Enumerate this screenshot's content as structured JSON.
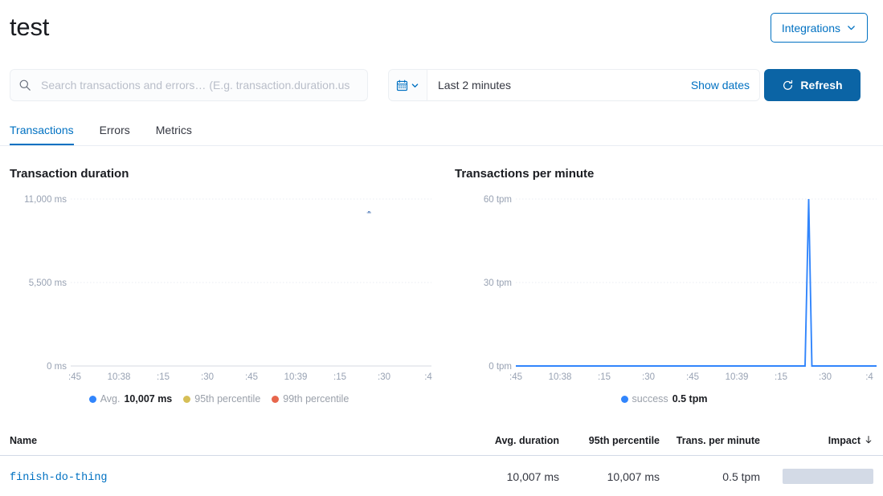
{
  "header": {
    "title": "test",
    "integrations_label": "Integrations",
    "integrations_icon": "chevron-down-icon"
  },
  "search": {
    "icon": "search-icon",
    "placeholder": "Search transactions and errors… (E.g. transaction.duration.us",
    "value": ""
  },
  "datepicker": {
    "calendar_icon": "calendar-icon",
    "chevron_icon": "chevron-down-icon",
    "range_label": "Last 2 minutes",
    "show_dates_label": "Show dates"
  },
  "refresh": {
    "label": "Refresh",
    "icon": "refresh-icon",
    "color": "#0b64a5"
  },
  "tabs": [
    {
      "label": "Transactions",
      "active": true
    },
    {
      "label": "Errors",
      "active": false
    },
    {
      "label": "Metrics",
      "active": false
    }
  ],
  "colors": {
    "accent": "#0071c2",
    "series_blue": "#3185fc",
    "series_yellow": "#d6bf57",
    "series_orange": "#e7664c",
    "grid": "#e9edf3",
    "impact_bar": "#d3dae6"
  },
  "chart_data": [
    {
      "id": "transaction-duration",
      "type": "line",
      "title": "Transaction duration",
      "xlabel": "",
      "ylabel": "",
      "ylim": [
        0,
        11000
      ],
      "yticks": [
        0,
        5500,
        11000
      ],
      "ytick_labels": [
        "0 ms",
        "5,500 ms",
        "11,000 ms"
      ],
      "xtick_labels": [
        ":45",
        "10:38",
        ":15",
        ":30",
        ":45",
        "10:39",
        ":15",
        ":30",
        ":4"
      ],
      "grid": true,
      "legend_position": "bottom",
      "series": [
        {
          "name": "Avg.",
          "value_label": "10,007 ms",
          "color": "#3185fc",
          "points": [
            {
              "x_label": "10:39:18",
              "y": 10007
            }
          ]
        },
        {
          "name": "95th percentile",
          "value_label": "",
          "color": "#d6bf57",
          "points": []
        },
        {
          "name": "99th percentile",
          "value_label": "",
          "color": "#e7664c",
          "points": []
        }
      ]
    },
    {
      "id": "transactions-per-minute",
      "type": "line",
      "title": "Transactions per minute",
      "xlabel": "",
      "ylabel": "",
      "ylim": [
        0,
        60
      ],
      "yticks": [
        0,
        30,
        60
      ],
      "ytick_labels": [
        "0 tpm",
        "30 tpm",
        "60 tpm"
      ],
      "xtick_labels": [
        ":45",
        "10:38",
        ":15",
        ":30",
        ":45",
        "10:39",
        ":15",
        ":30",
        ":4"
      ],
      "grid": true,
      "legend_position": "bottom",
      "series": [
        {
          "name": "success",
          "value_label": "0.5 tpm",
          "color": "#3185fc",
          "points": [
            {
              "x": 0,
              "y": 0
            },
            {
              "x": 0.86,
              "y": 0
            },
            {
              "x": 0.875,
              "y": 60
            },
            {
              "x": 0.89,
              "y": 0
            },
            {
              "x": 1,
              "y": 0
            }
          ]
        }
      ]
    }
  ],
  "table": {
    "columns": [
      {
        "key": "name",
        "label": "Name",
        "sorted": false
      },
      {
        "key": "avg",
        "label": "Avg. duration",
        "sorted": false
      },
      {
        "key": "p95",
        "label": "95th percentile",
        "sorted": false
      },
      {
        "key": "tpm",
        "label": "Trans. per minute",
        "sorted": false
      },
      {
        "key": "impact",
        "label": "Impact",
        "sorted": true,
        "sort_icon": "arrow-down-icon"
      }
    ],
    "rows": [
      {
        "name": "finish-do-thing",
        "avg": "10,007 ms",
        "p95": "10,007 ms",
        "tpm": "0.5 tpm",
        "impact_pct": 100
      }
    ]
  }
}
